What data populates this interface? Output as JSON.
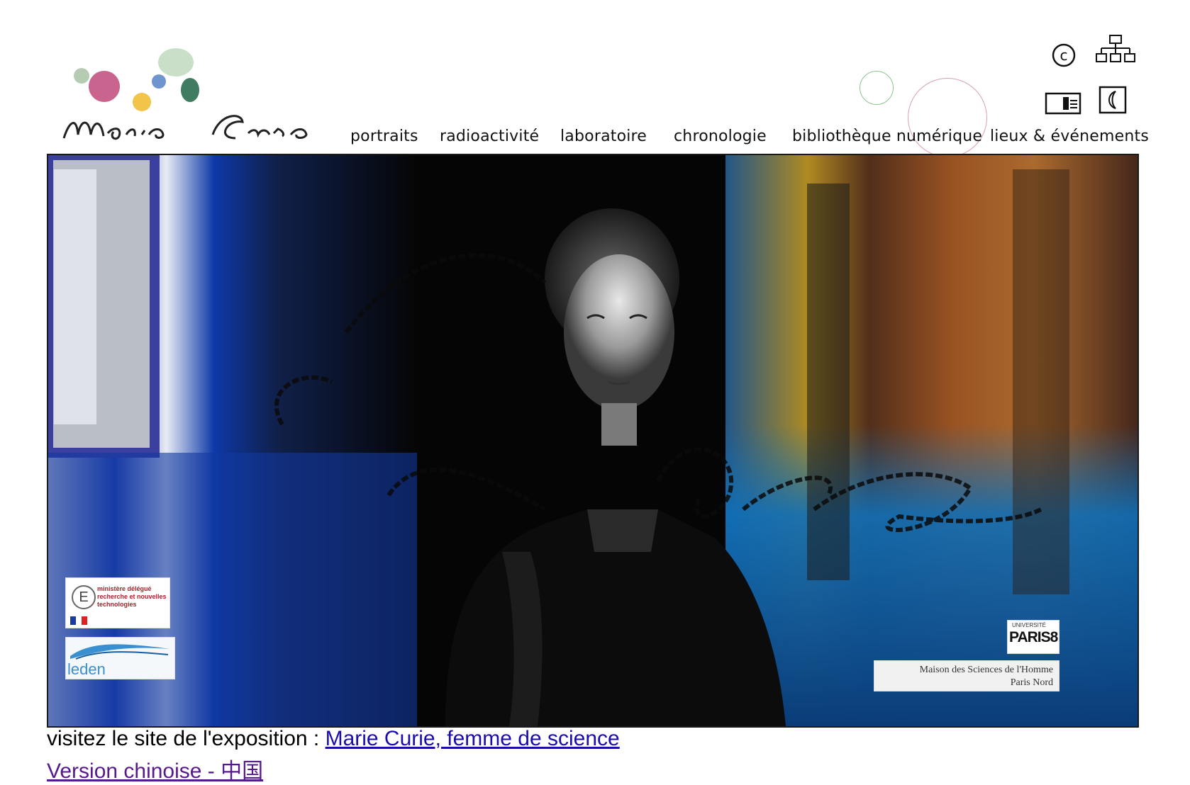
{
  "logo": {
    "script_text": "Marie Curie"
  },
  "toolbar": {
    "copyright_icon": "copyright-icon",
    "sitemap_icon": "sitemap-icon",
    "contact_card_icon": "contact-card-icon",
    "moon_icon": "moon-icon"
  },
  "nav": {
    "items": [
      {
        "label": "portraits"
      },
      {
        "label": "radioactivité"
      },
      {
        "label": "laboratoire"
      },
      {
        "label": "chronologie"
      },
      {
        "label": "bibliothèque numérique"
      },
      {
        "label": "lieux & événements"
      }
    ]
  },
  "banner": {
    "sponsors": {
      "ministry_line1": "ministère délégué",
      "ministry_line2": "recherche et nouvelles",
      "ministry_line3": "technologies",
      "leden": "leden",
      "paris8_small": "UNIVERSITÉ",
      "paris8": "PARIS8",
      "msh_line1": "Maison des Sciences de l'Homme",
      "msh_line2": "Paris Nord"
    }
  },
  "footer": {
    "visit_text": "visitez le site de l'exposition : ",
    "visit_link": "Marie Curie, femme de science",
    "chinese_link": "Version chinoise - 中国"
  },
  "colors": {
    "link_blue": "#1a0dab",
    "link_visited": "#551a8b",
    "dot_pink": "#c9638c",
    "dot_yellow": "#f3c64c",
    "dot_blue": "#6d93cf",
    "dot_green": "#3f7d63",
    "dot_sage": "#a8c4a8"
  }
}
